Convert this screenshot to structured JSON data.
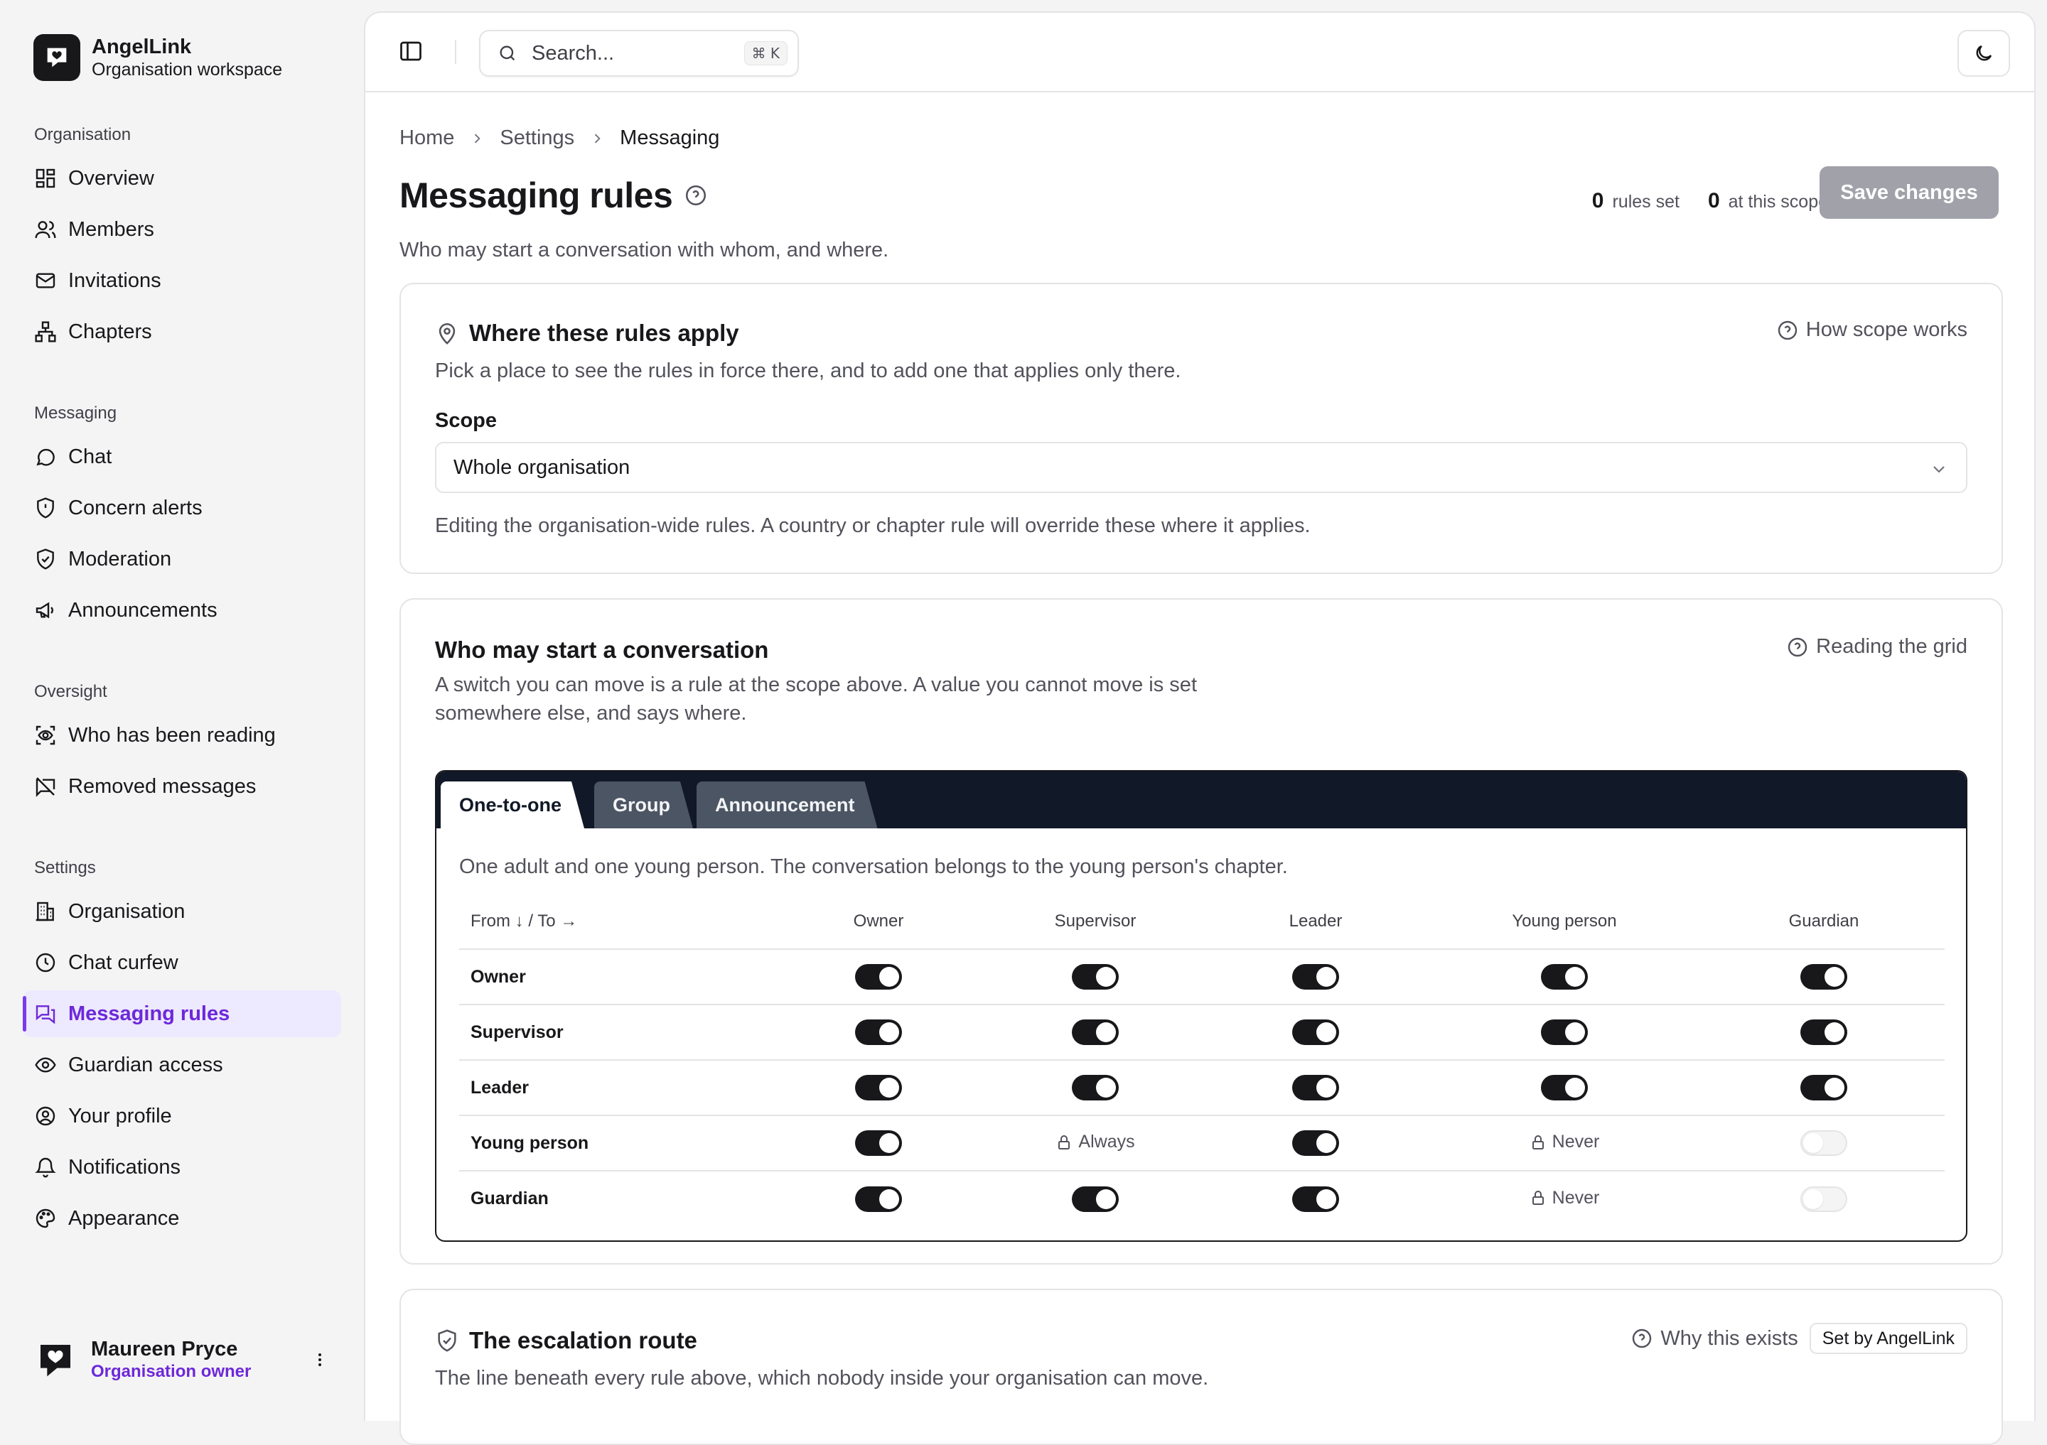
{
  "brand": {
    "name": "AngelLink",
    "subtitle": "Organisation workspace"
  },
  "sidebar": {
    "groups": [
      {
        "heading": "Organisation",
        "items": [
          {
            "label": "Overview",
            "icon": "dashboard-icon"
          },
          {
            "label": "Members",
            "icon": "users-icon"
          },
          {
            "label": "Invitations",
            "icon": "mail-icon"
          },
          {
            "label": "Chapters",
            "icon": "network-icon"
          }
        ]
      },
      {
        "heading": "Messaging",
        "items": [
          {
            "label": "Chat",
            "icon": "chat-bubble-icon"
          },
          {
            "label": "Concern alerts",
            "icon": "shield-alert-icon"
          },
          {
            "label": "Moderation",
            "icon": "shield-check-icon"
          },
          {
            "label": "Announcements",
            "icon": "megaphone-icon"
          }
        ]
      },
      {
        "heading": "Oversight",
        "items": [
          {
            "label": "Who has been reading",
            "icon": "scan-eye-icon"
          },
          {
            "label": "Removed messages",
            "icon": "message-off-icon"
          }
        ]
      },
      {
        "heading": "Settings",
        "items": [
          {
            "label": "Organisation",
            "icon": "building-icon"
          },
          {
            "label": "Chat curfew",
            "icon": "clock-icon"
          },
          {
            "label": "Messaging rules",
            "icon": "messages-icon",
            "active": true
          },
          {
            "label": "Guardian access",
            "icon": "eye-icon"
          },
          {
            "label": "Your profile",
            "icon": "user-circle-icon"
          },
          {
            "label": "Notifications",
            "icon": "bell-icon"
          },
          {
            "label": "Appearance",
            "icon": "palette-icon"
          }
        ]
      }
    ]
  },
  "user": {
    "name": "Maureen Pryce",
    "role": "Organisation owner"
  },
  "topbar": {
    "search_placeholder": "Search...",
    "search_shortcut": "⌘ K"
  },
  "breadcrumb": {
    "home": "Home",
    "settings": "Settings",
    "current": "Messaging"
  },
  "page": {
    "title": "Messaging rules",
    "subtitle": "Who may start a conversation with whom, and where.",
    "stats": {
      "rules_set_count": "0",
      "rules_set_label": "rules set",
      "scope_count": "0",
      "scope_label": "at this scope"
    },
    "save_label": "Save changes"
  },
  "scope_card": {
    "title": "Where these rules apply",
    "description": "Pick a place to see the rules in force there, and to add one that applies only there.",
    "help_link": "How scope works",
    "scope_label": "Scope",
    "scope_value": "Whole organisation",
    "note": "Editing the organisation-wide rules. A country or chapter rule will override these where it applies."
  },
  "grid_card": {
    "title": "Who may start a conversation",
    "help_link": "Reading the grid",
    "description_line1": "A switch you can move is a rule at the scope above. A value you cannot move is set",
    "description_line2": "somewhere else, and says where.",
    "tabs": [
      "One-to-one",
      "Group",
      "Announcement"
    ],
    "active_tab": "One-to-one",
    "tab_description": "One adult and one young person. The conversation belongs to the young person's chapter.",
    "corner_header": "From ↓ / To →",
    "columns": [
      "Owner",
      "Supervisor",
      "Leader",
      "Young person",
      "Guardian"
    ],
    "rows": [
      {
        "label": "Owner",
        "cells": [
          {
            "state": "on"
          },
          {
            "state": "on"
          },
          {
            "state": "on"
          },
          {
            "state": "on"
          },
          {
            "state": "on"
          }
        ]
      },
      {
        "label": "Supervisor",
        "cells": [
          {
            "state": "on"
          },
          {
            "state": "on"
          },
          {
            "state": "on"
          },
          {
            "state": "on"
          },
          {
            "state": "on"
          }
        ]
      },
      {
        "label": "Leader",
        "cells": [
          {
            "state": "on"
          },
          {
            "state": "on"
          },
          {
            "state": "on"
          },
          {
            "state": "on"
          },
          {
            "state": "on"
          }
        ]
      },
      {
        "label": "Young person",
        "cells": [
          {
            "state": "on"
          },
          {
            "state": "locked",
            "text": "Always"
          },
          {
            "state": "on"
          },
          {
            "state": "locked",
            "text": "Never"
          },
          {
            "state": "off"
          }
        ]
      },
      {
        "label": "Guardian",
        "cells": [
          {
            "state": "on"
          },
          {
            "state": "on"
          },
          {
            "state": "on"
          },
          {
            "state": "locked",
            "text": "Never"
          },
          {
            "state": "off"
          }
        ]
      }
    ]
  },
  "escalation_card": {
    "title": "The escalation route",
    "help_link": "Why this exists",
    "badge": "Set by AngelLink",
    "description": "The line beneath every rule above, which nobody inside your organisation can move."
  },
  "colors": {
    "accent": "#6d28d9",
    "accent_bg": "#ede9fe",
    "tab_strip": "#111827",
    "switch_on": "#18181b",
    "save_disabled": "#a1a1aa"
  }
}
